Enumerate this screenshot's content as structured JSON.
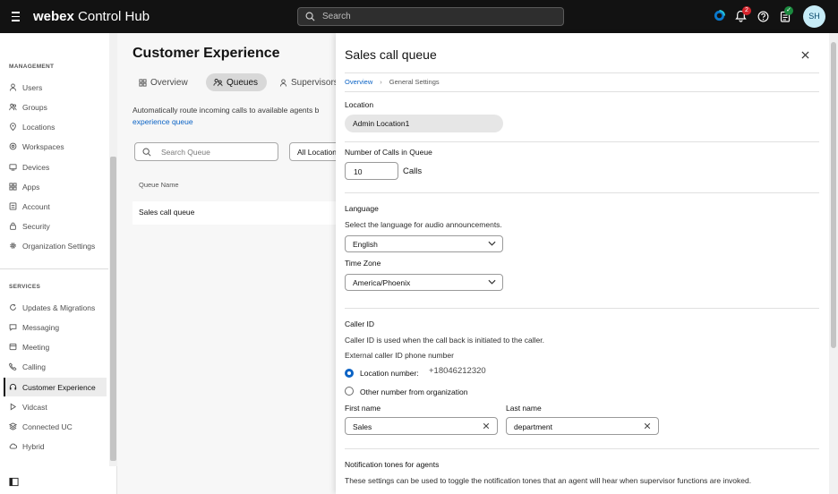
{
  "topbar": {
    "brand_bold": "webex",
    "brand_rest": " Control Hub",
    "search_placeholder": "Search",
    "notification_count": "2",
    "avatar_initials": "SH",
    "colors": {
      "bar": "#121212",
      "badge_red": "#d4232b",
      "badge_green": "#1b8a3f"
    }
  },
  "sidebar": {
    "management_label": "MANAGEMENT",
    "management_items": [
      {
        "label": "Users",
        "icon": "user-icon"
      },
      {
        "label": "Groups",
        "icon": "groups-icon"
      },
      {
        "label": "Locations",
        "icon": "location-pin-icon"
      },
      {
        "label": "Workspaces",
        "icon": "workspaces-icon"
      },
      {
        "label": "Devices",
        "icon": "devices-icon"
      },
      {
        "label": "Apps",
        "icon": "apps-icon"
      },
      {
        "label": "Account",
        "icon": "account-icon"
      },
      {
        "label": "Security",
        "icon": "lock-icon"
      },
      {
        "label": "Organization Settings",
        "icon": "gear-icon"
      }
    ],
    "services_label": "SERVICES",
    "services_items": [
      {
        "label": "Updates & Migrations",
        "icon": "refresh-icon"
      },
      {
        "label": "Messaging",
        "icon": "chat-icon"
      },
      {
        "label": "Meeting",
        "icon": "meeting-icon"
      },
      {
        "label": "Calling",
        "icon": "phone-icon"
      },
      {
        "label": "Customer Experience",
        "icon": "headset-icon",
        "active": true
      },
      {
        "label": "Vidcast",
        "icon": "play-icon"
      },
      {
        "label": "Connected UC",
        "icon": "layers-icon"
      },
      {
        "label": "Hybrid",
        "icon": "cloud-icon"
      }
    ]
  },
  "main": {
    "title": "Customer Experience",
    "tabs": [
      {
        "label": "Overview",
        "icon": "grid-icon"
      },
      {
        "label": "Queues",
        "icon": "queues-icon",
        "selected": true
      },
      {
        "label": "Supervisors",
        "icon": "supervisor-icon"
      }
    ],
    "description": "Automatically route incoming calls to available agents b",
    "description_link": "experience queue",
    "search_placeholder": "Search Queue",
    "location_filter": "All Locations",
    "table": {
      "column_header": "Queue Name",
      "rows": [
        "Sales call queue"
      ]
    }
  },
  "panel": {
    "title": "Sales call queue",
    "breadcrumb": {
      "root": "Overview",
      "current": "General Settings"
    },
    "location": {
      "label": "Location",
      "value": "Admin Location1"
    },
    "calls_in_queue": {
      "label": "Number of Calls in Queue",
      "value": "10",
      "unit": "Calls"
    },
    "language": {
      "label": "Language",
      "description": "Select the language for audio announcements.",
      "value": "English"
    },
    "timezone": {
      "label": "Time Zone",
      "value": "America/Phoenix"
    },
    "caller_id": {
      "label": "Caller ID",
      "description": "Caller ID is used when the call back is initiated to the caller.",
      "external_label": "External caller ID phone number",
      "option_location": "Location number:",
      "location_number": "+18046212320",
      "option_other": "Other number from organization",
      "selected": "location"
    },
    "name": {
      "first_label": "First name",
      "first_value": "Sales",
      "last_label": "Last name",
      "last_value": "department"
    },
    "notification": {
      "label": "Notification tones for agents",
      "description": "These settings can be used to toggle the notification tones that an agent will hear when supervisor functions are invoked."
    },
    "accent": "#0b63c5"
  }
}
